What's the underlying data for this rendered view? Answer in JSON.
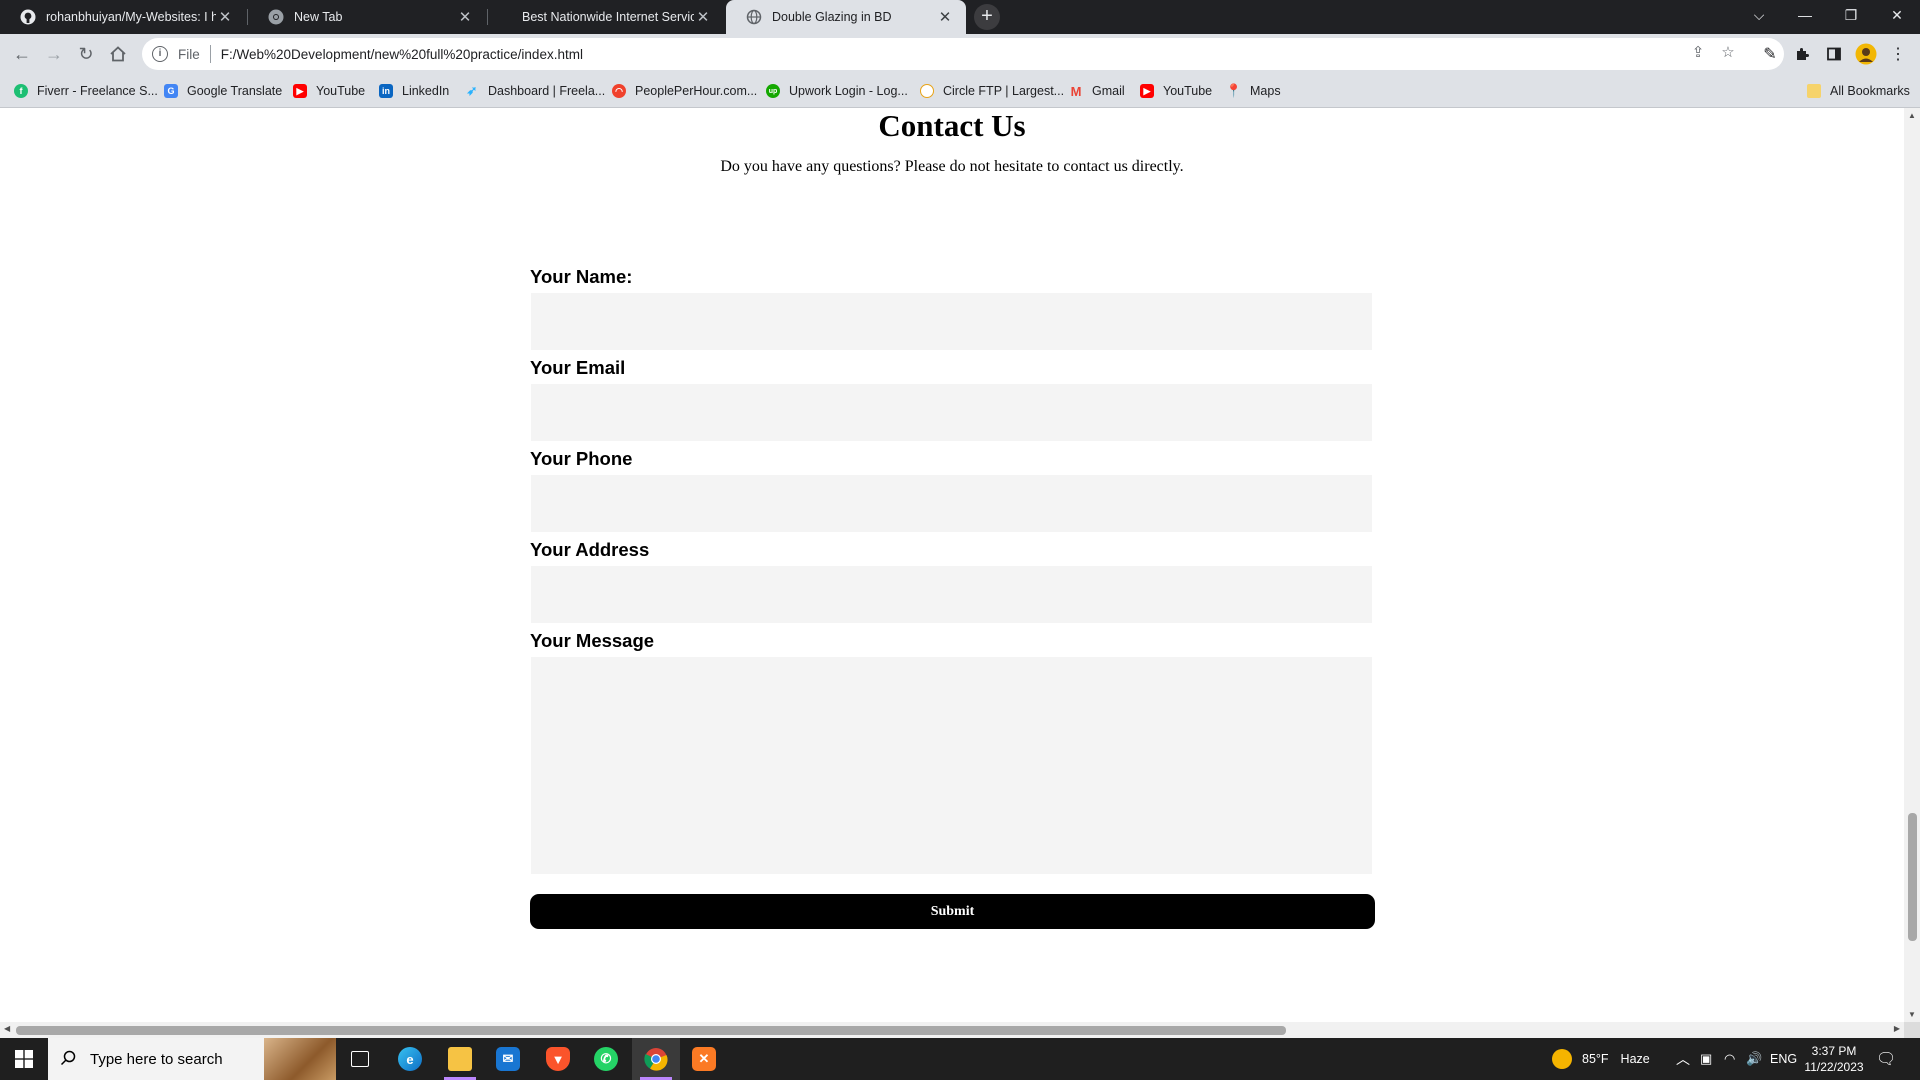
{
  "browser": {
    "tabs": [
      {
        "title": "rohanbhuiyan/My-Websites: I ha",
        "icon": "github-icon",
        "active": false
      },
      {
        "title": "New Tab",
        "icon": "chrome-icon",
        "active": false
      },
      {
        "title": "Best Nationwide Internet Service",
        "icon": "none",
        "active": false
      },
      {
        "title": "Double Glazing in BD",
        "icon": "globe-icon",
        "active": true
      }
    ],
    "address": {
      "scheme": "File",
      "url": "F:/Web%20Development/new%20full%20practice/index.html"
    },
    "bookmarks": [
      {
        "label": "Fiverr - Freelance S...",
        "icon": "fiverr-icon",
        "color": "#1dbf73"
      },
      {
        "label": "Google Translate",
        "icon": "translate-icon",
        "color": "#4285f4"
      },
      {
        "label": "YouTube",
        "icon": "youtube-icon",
        "color": "#ff0000"
      },
      {
        "label": "LinkedIn",
        "icon": "linkedin-icon",
        "color": "#0a66c2"
      },
      {
        "label": "Dashboard | Freela...",
        "icon": "freelancer-icon",
        "color": "#29b2fe"
      },
      {
        "label": "PeoplePerHour.com...",
        "icon": "peopleperhour-icon",
        "color": "#f0412c"
      },
      {
        "label": "Upwork Login - Log...",
        "icon": "upwork-icon",
        "color": "#14a800"
      },
      {
        "label": "Circle FTP | Largest...",
        "icon": "circleftp-icon",
        "color": "#e8a317"
      },
      {
        "label": "Gmail",
        "icon": "gmail-icon",
        "color": "#ea4335"
      },
      {
        "label": "YouTube",
        "icon": "youtube-icon",
        "color": "#ff0000"
      },
      {
        "label": "Maps",
        "icon": "maps-icon",
        "color": "#34a853"
      }
    ],
    "all_bookmarks": "All Bookmarks"
  },
  "page": {
    "title": "Contact Us",
    "subtitle": "Do you have any questions? Please do not hesitate to contact us directly.",
    "form": {
      "name_label": "Your Name:",
      "email_label": "Your Email",
      "phone_label": "Your Phone",
      "address_label": "Your Address",
      "message_label": "Your Message",
      "name_value": "",
      "email_value": "",
      "phone_value": "",
      "address_value": "",
      "message_value": "",
      "submit_label": "Submit"
    }
  },
  "taskbar": {
    "search_placeholder": "Type here to search",
    "weather_temp": "85°F",
    "weather_desc": "Haze",
    "language": "ENG",
    "time": "3:37 PM",
    "date": "11/22/2023"
  }
}
